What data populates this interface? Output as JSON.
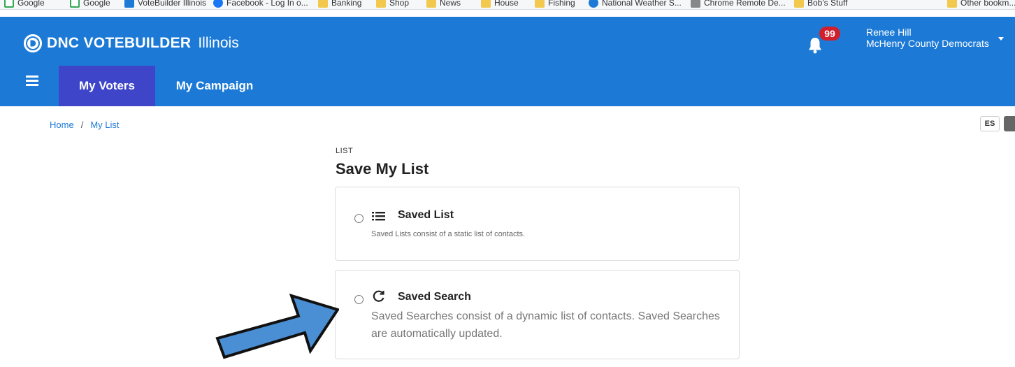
{
  "bookmarks": [
    "Google",
    "Google",
    "VoteBuilder Illinois",
    "Facebook - Log In o...",
    "Banking",
    "Shop",
    "News",
    "House",
    "Fishing",
    "National Weather S...",
    "Chrome Remote De...",
    "Bob's Stuff",
    "Other bookm..."
  ],
  "header": {
    "brand_name": "DNC VOTEBUILDER",
    "brand_state": "Illinois",
    "notification_count": "99",
    "user_name": "Renee Hill",
    "user_org": "McHenry County Democrats"
  },
  "nav": {
    "tabs": [
      {
        "label": "My Voters",
        "active": true
      },
      {
        "label": "My Campaign",
        "active": false
      }
    ]
  },
  "breadcrumb": {
    "home": "Home",
    "separator": "/",
    "current": "My List"
  },
  "language": {
    "code": "ES"
  },
  "page": {
    "eyebrow": "LIST",
    "title": "Save My List"
  },
  "options": [
    {
      "title": "Saved List",
      "description": "Saved Lists consist of a static list of contacts.",
      "icon": "list-icon",
      "selected": false
    },
    {
      "title": "Saved Search",
      "description": "Saved Searches consist of a dynamic list of contacts. Saved Searches are automatically updated.",
      "icon": "refresh-icon",
      "selected": false
    }
  ],
  "colors": {
    "header_blue": "#1c7ad6",
    "active_tab": "#3f45c8",
    "badge_red": "#d0202e",
    "annotation_arrow": "#4a8fd4"
  }
}
